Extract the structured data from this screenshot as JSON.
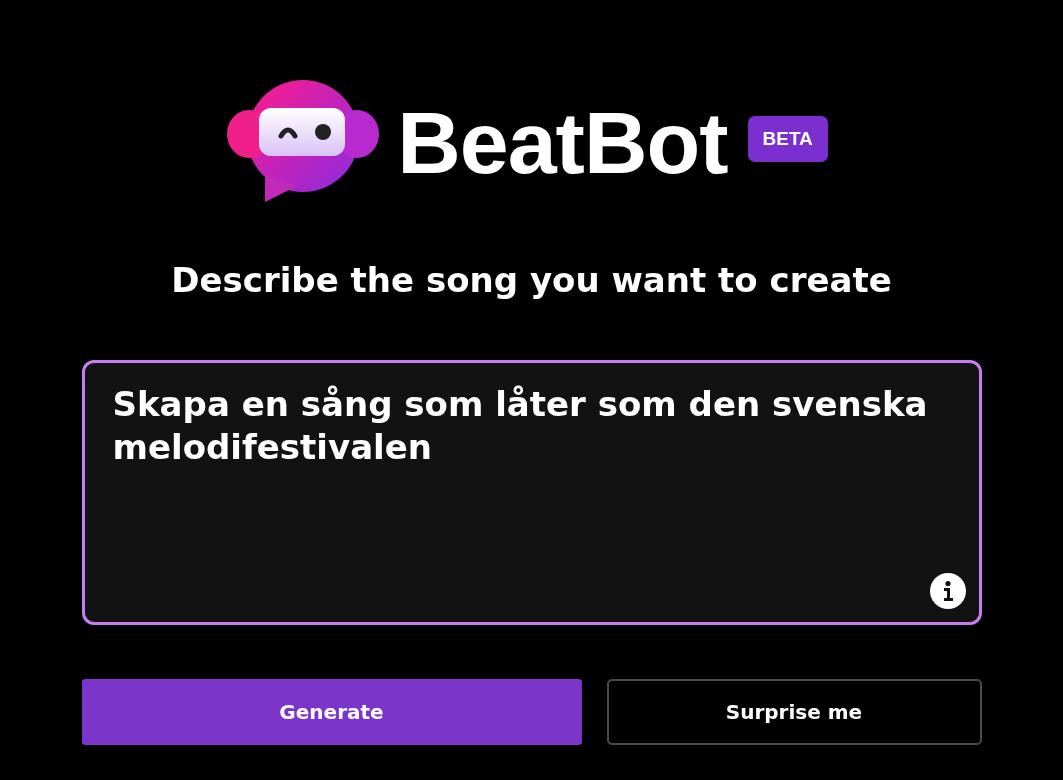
{
  "logo": {
    "name": "BeatBot",
    "badge": "BETA"
  },
  "heading": "Describe the song you want to create",
  "prompt": {
    "value": "Skapa en sång som låter som den svenska melodifestivalen"
  },
  "buttons": [
    {
      "label": "Generate",
      "kind": "primary"
    },
    {
      "label": "Surprise me",
      "kind": "secondary"
    }
  ]
}
